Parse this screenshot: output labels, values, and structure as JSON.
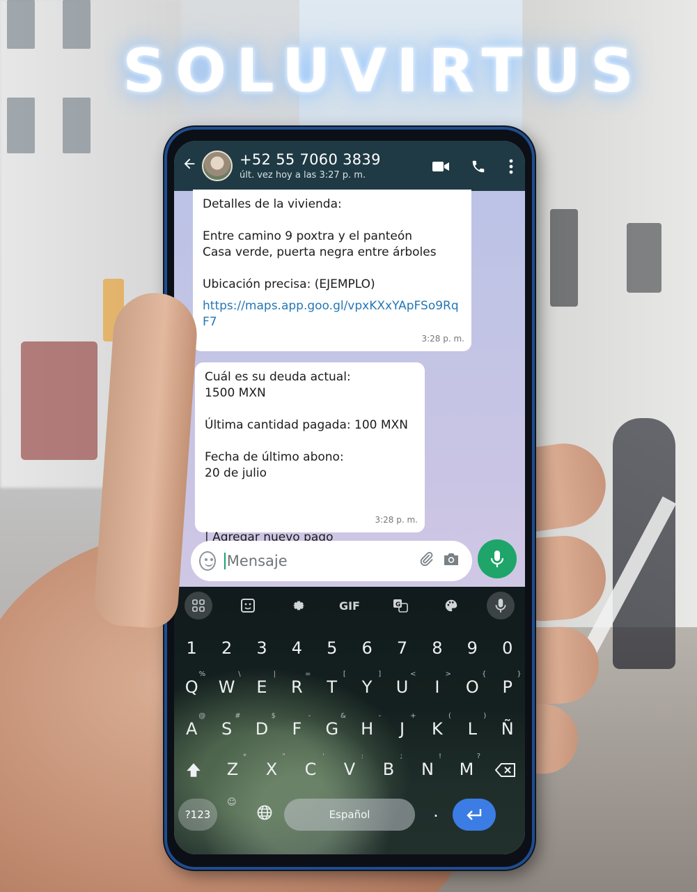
{
  "watermark": "SOLUVIRTUS",
  "header": {
    "contact_name": "+52 55 7060 3839",
    "status": "últ. vez hoy a las 3:27 p. m.",
    "icons": [
      "back-icon",
      "avatar",
      "video-call-icon",
      "phone-icon",
      "more-vert-icon"
    ]
  },
  "messages": [
    {
      "text": "Detalles de la vivienda:\n\nEntre camino 9 poxtra y el panteón\nCasa verde, puerta negra entre árboles\n\nUbicación precisa: (EJEMPLO)",
      "link": "https://maps.app.goo.gl/vpxKXxYApFSo9RqF7",
      "time": "3:28 p. m."
    },
    {
      "text": "Cuál es su deuda actual:\n1500 MXN\n\nÚltima cantidad pagada:  100 MXN\n\nFecha de último abono:\n20 de julio\n\n\n\n|  Agregar nuevo pago",
      "time": "3:28 p. m."
    }
  ],
  "composer": {
    "placeholder": "Mensaje",
    "icons": [
      "emoji-icon",
      "attach-icon",
      "camera-icon",
      "mic-icon"
    ]
  },
  "keyboard": {
    "toolbar": [
      "grid-icon",
      "sticker-icon",
      "settings-icon",
      "GIF",
      "translate-icon",
      "palette-icon",
      "mic-icon"
    ],
    "gif_label": "GIF",
    "row1": [
      "1",
      "2",
      "3",
      "4",
      "5",
      "6",
      "7",
      "8",
      "9",
      "0"
    ],
    "row2": [
      {
        "k": "Q",
        "h": "%"
      },
      {
        "k": "W",
        "h": "\\"
      },
      {
        "k": "E",
        "h": "|"
      },
      {
        "k": "R",
        "h": "="
      },
      {
        "k": "T",
        "h": "["
      },
      {
        "k": "Y",
        "h": "]"
      },
      {
        "k": "U",
        "h": "<"
      },
      {
        "k": "I",
        "h": ">"
      },
      {
        "k": "O",
        "h": "{"
      },
      {
        "k": "P",
        "h": "}"
      }
    ],
    "row3": [
      {
        "k": "A",
        "h": "@"
      },
      {
        "k": "S",
        "h": "#"
      },
      {
        "k": "D",
        "h": "$"
      },
      {
        "k": "F",
        "h": "-"
      },
      {
        "k": "G",
        "h": "&"
      },
      {
        "k": "H",
        "h": "-"
      },
      {
        "k": "J",
        "h": "+"
      },
      {
        "k": "K",
        "h": "("
      },
      {
        "k": "L",
        "h": ")"
      },
      {
        "k": "Ñ",
        "h": ""
      }
    ],
    "row4": [
      {
        "k": "Z",
        "h": "*"
      },
      {
        "k": "X",
        "h": "\""
      },
      {
        "k": "C",
        "h": "'"
      },
      {
        "k": "V",
        "h": ":"
      },
      {
        "k": "B",
        "h": ";"
      },
      {
        "k": "N",
        "h": "!"
      },
      {
        "k": "M",
        "h": "?"
      }
    ],
    "symbols_key": "?123",
    "space_label": "Español",
    "period": "."
  }
}
